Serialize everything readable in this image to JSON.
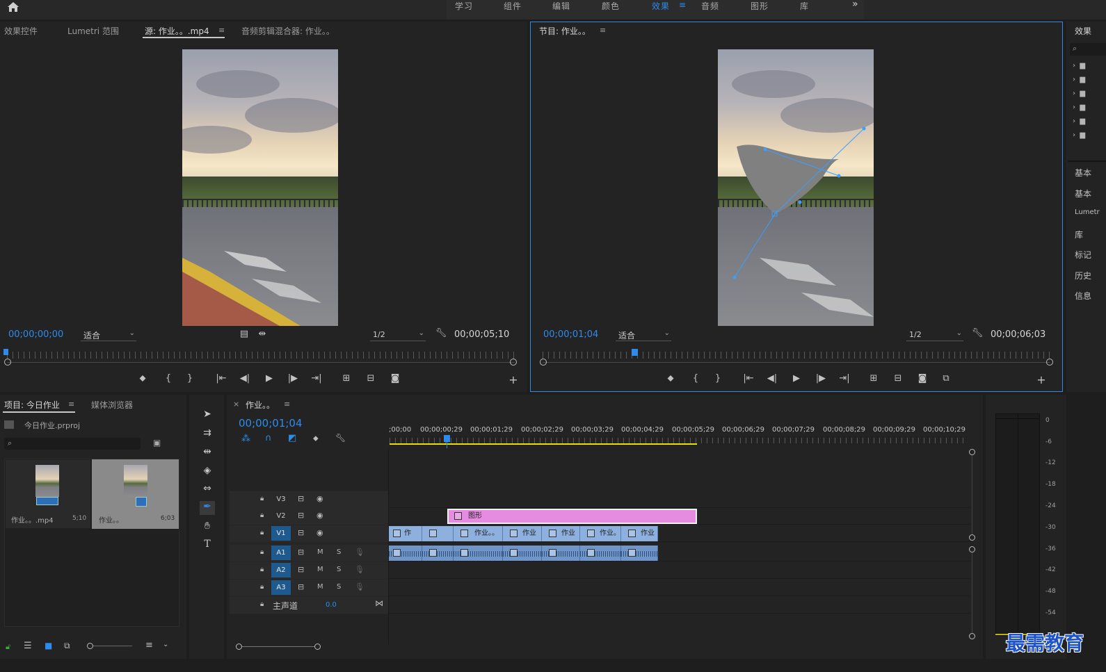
{
  "topbar": {
    "workspaces": [
      {
        "label": "学习",
        "active": false
      },
      {
        "label": "组件",
        "active": false
      },
      {
        "label": "编辑",
        "active": false
      },
      {
        "label": "颜色",
        "active": false
      },
      {
        "label": "效果",
        "active": true
      },
      {
        "label": "音频",
        "active": false
      },
      {
        "label": "图形",
        "active": false
      },
      {
        "label": "库",
        "active": false
      }
    ],
    "more": "»"
  },
  "source_panel": {
    "tabs": [
      "效果控件",
      "Lumetri 范围",
      "源: 作业。。.mp4",
      "音频剪辑混合器: 作业。。"
    ],
    "active_tab": 2,
    "menu_glyph": "≡",
    "timecode_current": "00;00;00;00",
    "fit": "适合",
    "resolution": "1/2",
    "timecode_duration": "00;00;05;10"
  },
  "program_panel": {
    "title": "节目: 作业。。",
    "menu_glyph": "≡",
    "timecode_current": "00;00;01;04",
    "fit": "适合",
    "resolution": "1/2",
    "timecode_duration": "00;00;06;03"
  },
  "project_panel": {
    "tabs": [
      "项目: 今日作业",
      "媒体浏览器"
    ],
    "menu_glyph": "≡",
    "project_file": "今日作业.prproj",
    "search_placeholder": "",
    "items": [
      {
        "name": "作业。。.mp4",
        "duration": "5;10"
      },
      {
        "name": "作业。。",
        "duration": "6;03"
      }
    ]
  },
  "timeline": {
    "close": "×",
    "title": "作业。。",
    "menu_glyph": "≡",
    "timecode": "00;00;01;04",
    "ruler_labels": [
      ";00;00",
      "00;00;00;29",
      "00;00;01;29",
      "00;00;02;29",
      "00;00;03;29",
      "00;00;04;29",
      "00;00;05;29",
      "00;00;06;29",
      "00;00;07;29",
      "00;00;08;29",
      "00;00;09;29",
      "00;00;10;29"
    ],
    "video_tracks": [
      "V3",
      "V2",
      "V1"
    ],
    "audio_tracks": [
      "A1",
      "A2",
      "A3"
    ],
    "mute": "M",
    "solo": "S",
    "master_label": "主声道",
    "master_value": "0.0",
    "graphic_clip_label": "图形",
    "v1_clips": [
      "作",
      "",
      "作业。。",
      "作业",
      "作业",
      "作业。",
      "作业"
    ]
  },
  "audio_meter": {
    "scale": [
      "0",
      "-6",
      "-12",
      "-18",
      "-24",
      "-30",
      "-36",
      "-42",
      "-48",
      "-54"
    ]
  },
  "right_panel": {
    "title": "效果",
    "items": [
      "基本",
      "基本",
      "Lumetr",
      "库",
      "标记",
      "历史",
      "信息"
    ]
  },
  "watermark": "最需教育",
  "colors": {
    "accent": "#2d8ceb",
    "graphic_clip": "#e58be0",
    "video_clip": "#8eb0de",
    "audio_clip": "#6f95c9",
    "in_out_bar": "#e8e000"
  }
}
